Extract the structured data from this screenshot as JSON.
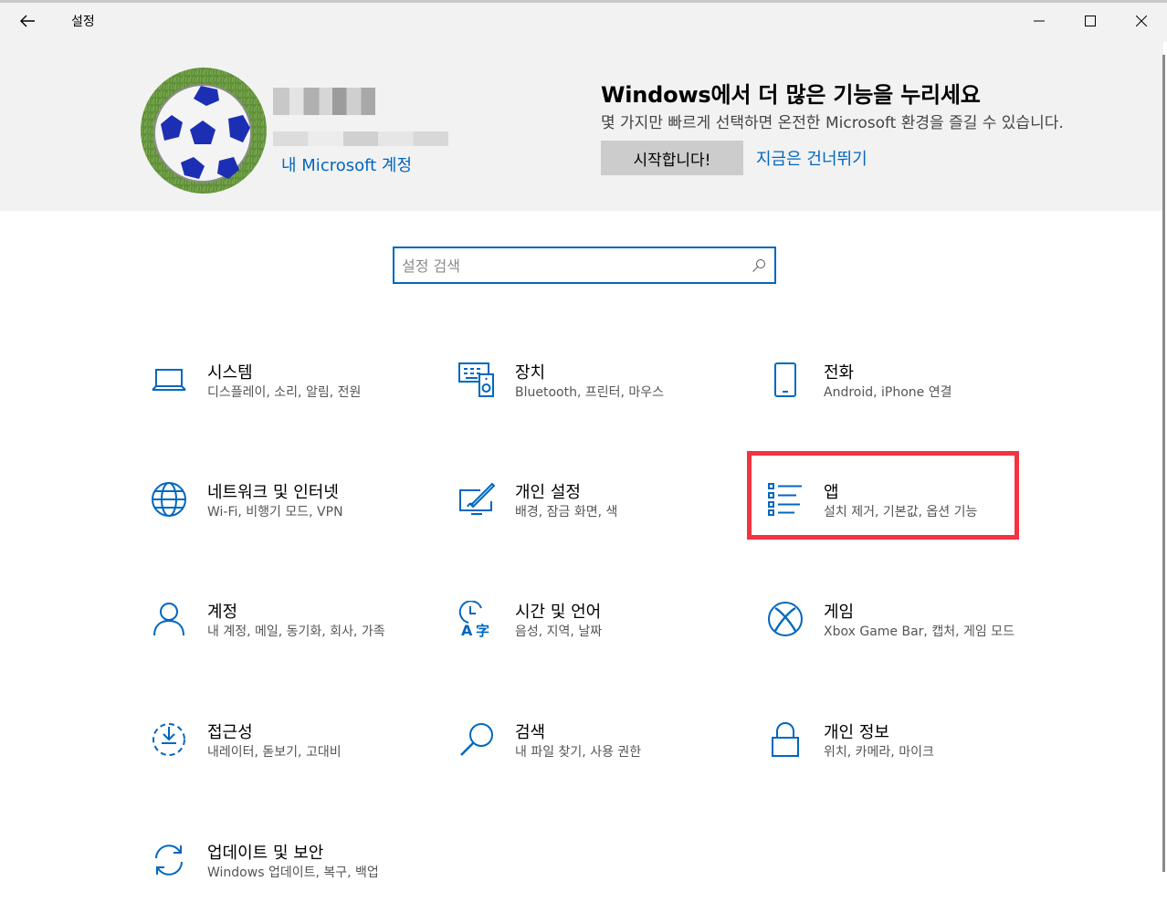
{
  "window": {
    "title": "설정",
    "back_label": "뒤로",
    "minimize_label": "최소화",
    "maximize_label": "최대화",
    "close_label": "닫기"
  },
  "account": {
    "link": "내 Microsoft 계정"
  },
  "promo": {
    "title": "Windows에서 더 많은 기능을 누리세요",
    "subtitle": "몇 가지만 빠르게 선택하면 온전한 Microsoft 환경을 즐길 수 있습니다.",
    "start_button": "시작합니다!",
    "skip_link": "지금은 건너뛰기"
  },
  "search": {
    "placeholder": "설정 검색"
  },
  "tiles": [
    {
      "title": "시스템",
      "desc": "디스플레이, 소리, 알림, 전원",
      "icon": "laptop-icon"
    },
    {
      "title": "장치",
      "desc": "Bluetooth, 프린터, 마우스",
      "icon": "devices-icon"
    },
    {
      "title": "전화",
      "desc": "Android, iPhone 연결",
      "icon": "phone-icon"
    },
    {
      "title": "네트워크 및 인터넷",
      "desc": "Wi-Fi, 비행기 모드, VPN",
      "icon": "globe-icon"
    },
    {
      "title": "개인 설정",
      "desc": "배경, 잠금 화면, 색",
      "icon": "paintbrush-icon"
    },
    {
      "title": "앱",
      "desc": "설치 제거, 기본값, 옵션 기능",
      "icon": "apps-list-icon"
    },
    {
      "title": "계정",
      "desc": "내 계정, 메일, 동기화, 회사, 가족",
      "icon": "person-icon"
    },
    {
      "title": "시간 및 언어",
      "desc": "음성, 지역, 날짜",
      "icon": "time-language-icon"
    },
    {
      "title": "게임",
      "desc": "Xbox Game Bar, 캡처, 게임 모드",
      "icon": "xbox-icon"
    },
    {
      "title": "접근성",
      "desc": "내레이터, 돋보기, 고대비",
      "icon": "accessibility-icon"
    },
    {
      "title": "검색",
      "desc": "내 파일 찾기, 사용 권한",
      "icon": "search-icon"
    },
    {
      "title": "개인 정보",
      "desc": "위치, 카메라, 마이크",
      "icon": "lock-icon"
    },
    {
      "title": "업데이트 및 보안",
      "desc": "Windows 업데이트, 복구, 백업",
      "icon": "sync-icon"
    }
  ],
  "colors": {
    "accent": "#0067c0",
    "highlight_box": "#f3333f",
    "banner_bg": "#f2f2f2"
  }
}
